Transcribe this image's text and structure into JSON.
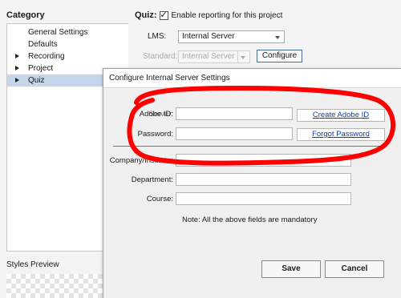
{
  "sidebar": {
    "heading": "Category",
    "items": [
      {
        "label": "General Settings"
      },
      {
        "label": "Defaults"
      },
      {
        "label": "Recording"
      },
      {
        "label": "Project"
      },
      {
        "label": "Quiz"
      }
    ],
    "styles_preview_label": "Styles Preview"
  },
  "quiz": {
    "label": "Quiz:",
    "enable_reporting_checked": true,
    "enable_reporting_text": "Enable reporting for this project",
    "lms_label": "LMS:",
    "lms_value": "Internal Server",
    "standard_label": "Standard:",
    "standard_value": "Internal Server",
    "configure_label": "Configure"
  },
  "dialog": {
    "title": "Configure Internal Server Settings",
    "adobe_id_label": "Adobe ID:",
    "adobe_id_overlap_label": "Server:",
    "adobe_id_value": "",
    "password_label": "Password:",
    "password_value": "",
    "create_adobe_id_label": "Create Adobe ID",
    "forgot_password_label": "Forgot Password",
    "company_label": "Company/Institute:",
    "company_value": "",
    "department_label": "Department:",
    "department_value": "",
    "course_label": "Course:",
    "course_value": "",
    "note": "Note: All the above fields are mandatory",
    "save_label": "Save",
    "cancel_label": "Cancel"
  },
  "colors": {
    "annotation": "#ff0000",
    "selection": "#c5d5ea",
    "link": "#0b3fb2"
  }
}
